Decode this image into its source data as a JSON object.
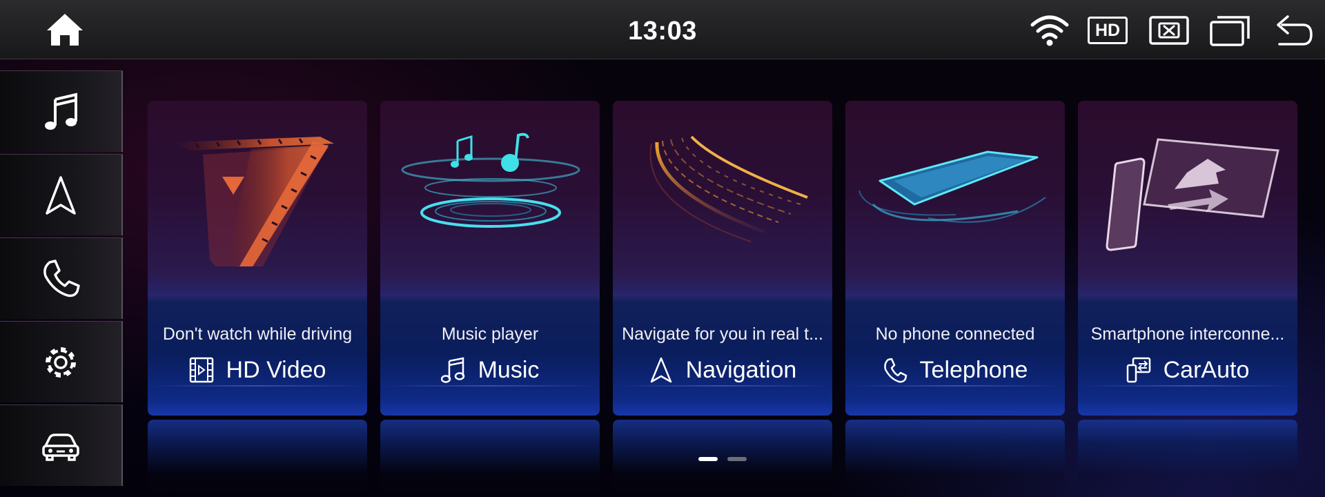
{
  "status_bar": {
    "time": "13:03",
    "hd_label": "HD",
    "icons": [
      "home-icon",
      "wifi-icon",
      "hd-icon",
      "close-window-icon",
      "multi-window-icon",
      "back-icon"
    ]
  },
  "sidebar": {
    "items": [
      {
        "name": "music",
        "icon": "music-note-icon"
      },
      {
        "name": "navigation",
        "icon": "navigation-arrow-icon"
      },
      {
        "name": "telephone",
        "icon": "phone-icon"
      },
      {
        "name": "settings",
        "icon": "gear-icon"
      },
      {
        "name": "car",
        "icon": "car-icon"
      }
    ]
  },
  "cards": [
    {
      "subtitle": "Don't watch while driving",
      "title": "HD Video",
      "icon": "video-icon"
    },
    {
      "subtitle": "Music player",
      "title": "Music",
      "icon": "music-note-icon"
    },
    {
      "subtitle": "Navigate for you in real t...",
      "title": "Navigation",
      "icon": "navigation-arrow-icon"
    },
    {
      "subtitle": "No phone connected",
      "title": "Telephone",
      "icon": "phone-icon"
    },
    {
      "subtitle": "Smartphone interconne...",
      "title": "CarAuto",
      "icon": "phone-mirror-icon"
    }
  ],
  "pager": {
    "pages": 2,
    "current": 1
  },
  "colors": {
    "accent_cyan": "#3fe0e8",
    "accent_orange": "#e8922a",
    "card_blue": "#1837a8",
    "card_purple": "#2b0c2c"
  }
}
